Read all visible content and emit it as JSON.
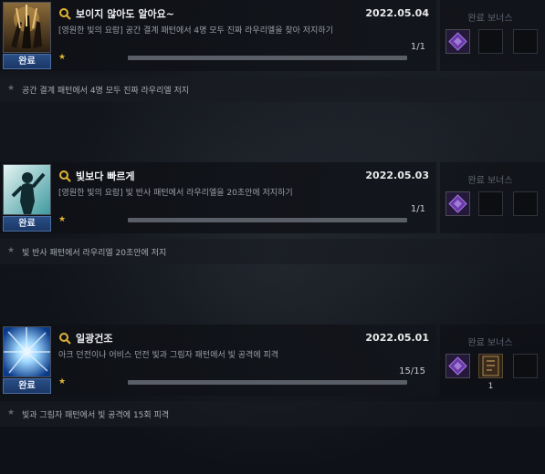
{
  "bonus_header": "완료 보너스",
  "achievements": [
    {
      "title": "보이지 않아도 알아요~",
      "date": "2022.05.04",
      "description": "[영원한 빛의 요람] 공간 결계 패턴에서 4명 모두 진짜 라우리엘을 찾아 저지하기",
      "count": "1/1",
      "progress": 1.0,
      "status": "완료",
      "objective": "공간 결계 패턴에서 4명 모두 진짜 라우리엘 저지",
      "reward_qty": "",
      "icon": "weapons-trophy-icon"
    },
    {
      "title": "빛보다 빠르게",
      "date": "2022.05.03",
      "description": "[영원한 빛의 요람] 빛 반사 패턴에서 라우리엘을 20초안에 저지하기",
      "count": "1/1",
      "progress": 1.0,
      "status": "완료",
      "objective": "빛 반사 패턴에서 라우리엘 20초안에 저지",
      "reward_qty": "",
      "icon": "silhouette-pose-icon"
    },
    {
      "title": "일광건조",
      "date": "2022.05.01",
      "description": "아크 던전이나 어비스 던전 빛과 그림자 패턴에서 빛 공격에 피격",
      "count": "15/15",
      "progress": 1.0,
      "status": "완료",
      "objective": "빛과 그림자 패턴에서 빛 공격에 15회 피격",
      "reward_qty": "1",
      "icon": "light-burst-icon"
    }
  ],
  "colors": {
    "badge": "#1b3766",
    "star": "#e2b431",
    "reward_purple": "#6a3aa8"
  }
}
